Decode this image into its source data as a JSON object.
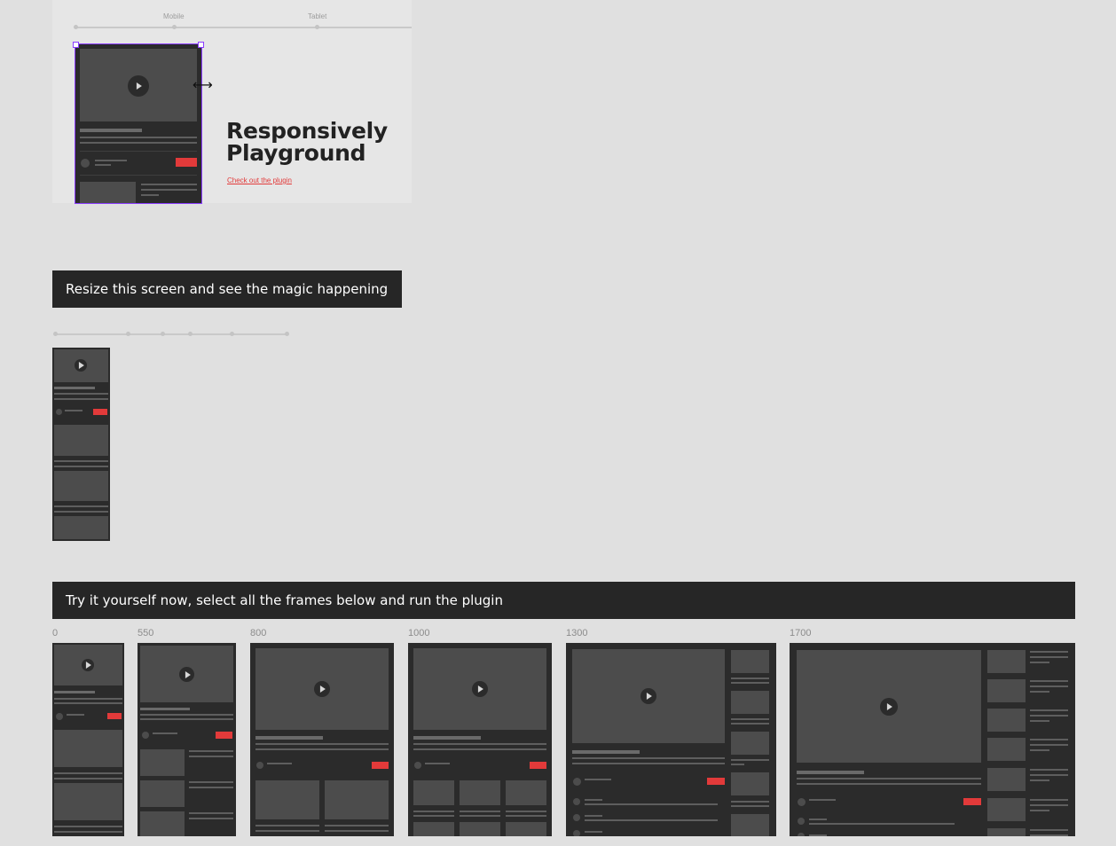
{
  "hero": {
    "breakpoints": [
      "Mobile",
      "Tablet"
    ],
    "title_line1": "Responsively",
    "title_line2": "Playground",
    "link": "Check out the plugin",
    "cursor_icon": "resize-horizontal-cursor"
  },
  "banner1": {
    "text": "Resize this screen and see the magic happening"
  },
  "banner2": {
    "text": "Try it yourself now, select all the frames below and run the plugin"
  },
  "frames": {
    "labels": [
      "0",
      "550",
      "800",
      "1000",
      "1300",
      "1700"
    ]
  },
  "colors": {
    "background": "#e0e0e0",
    "frame": "#2b2b2b",
    "placeholder": "#4c4c4c",
    "subscribe": "#e23a3a",
    "banner": "#262626",
    "selection": "#8b3dff"
  }
}
